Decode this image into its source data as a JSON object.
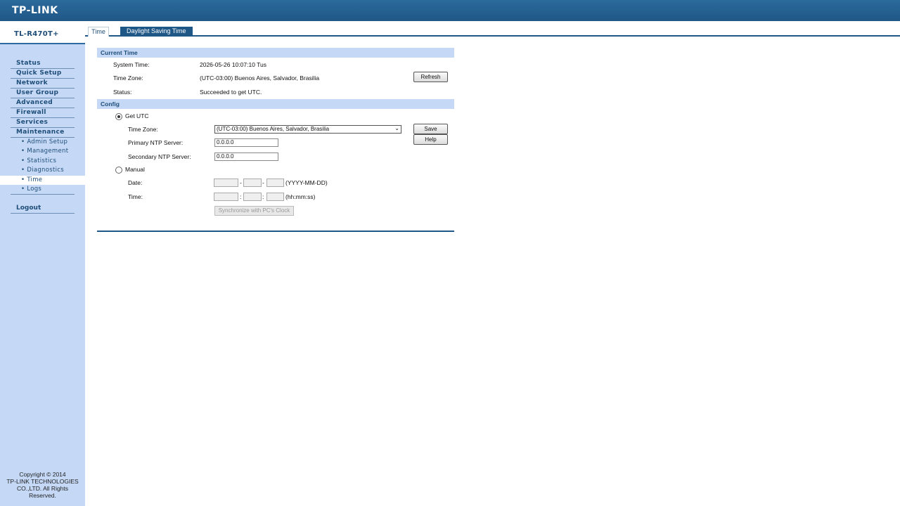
{
  "brand": {
    "logo_text": "TP-LINK",
    "model": "TL-R470T+"
  },
  "sidebar": {
    "items": [
      {
        "label": "Status"
      },
      {
        "label": "Quick Setup"
      },
      {
        "label": "Network"
      },
      {
        "label": "User Group"
      },
      {
        "label": "Advanced"
      },
      {
        "label": "Firewall"
      },
      {
        "label": "Services"
      },
      {
        "label": "Maintenance"
      }
    ],
    "sub_items": [
      {
        "label": "Admin Setup"
      },
      {
        "label": "Management"
      },
      {
        "label": "Statistics"
      },
      {
        "label": "Diagnostics"
      },
      {
        "label": "Time"
      },
      {
        "label": "Logs"
      }
    ],
    "logout": "Logout",
    "copyright": [
      "Copyright © 2014",
      "TP-LINK TECHNOLOGIES",
      "CO.,LTD. All Rights",
      "Reserved."
    ]
  },
  "tabs": {
    "time": "Time",
    "dst": "Daylight Saving Time"
  },
  "current_time": {
    "title": "Current Time",
    "system_time_label": "System Time:",
    "system_time_value": "2026-05-26 10:07:10 Tus",
    "time_zone_label": "Time Zone:",
    "time_zone_value": "(UTC-03:00) Buenos Aires, Salvador, Brasilia",
    "status_label": "Status:",
    "status_value": "Succeeded to get UTC.",
    "refresh_label": "Refresh"
  },
  "config": {
    "title": "Config",
    "get_utc_label": "Get UTC",
    "time_zone_label": "Time Zone:",
    "time_zone_selected": "(UTC-03:00) Buenos Aires, Salvador, Brasilia",
    "primary_ntp_label": "Primary NTP Server:",
    "primary_ntp_value": "0.0.0.0",
    "secondary_ntp_label": "Secondary NTP Server:",
    "secondary_ntp_value": "0.0.0.0",
    "manual_label": "Manual",
    "date_label": "Date:",
    "date_sep": "-",
    "date_format": "(YYYY-MM-DD)",
    "time_label": "Time:",
    "time_sep": ":",
    "time_format": "(hh:mm:ss)",
    "sync_label": "Synchronize with PC's Clock",
    "save_label": "Save",
    "help_label": "Help"
  },
  "colors": {
    "header": "#1f5786",
    "sidebar": "#c5d9f7",
    "section": "#c5d9f7"
  }
}
